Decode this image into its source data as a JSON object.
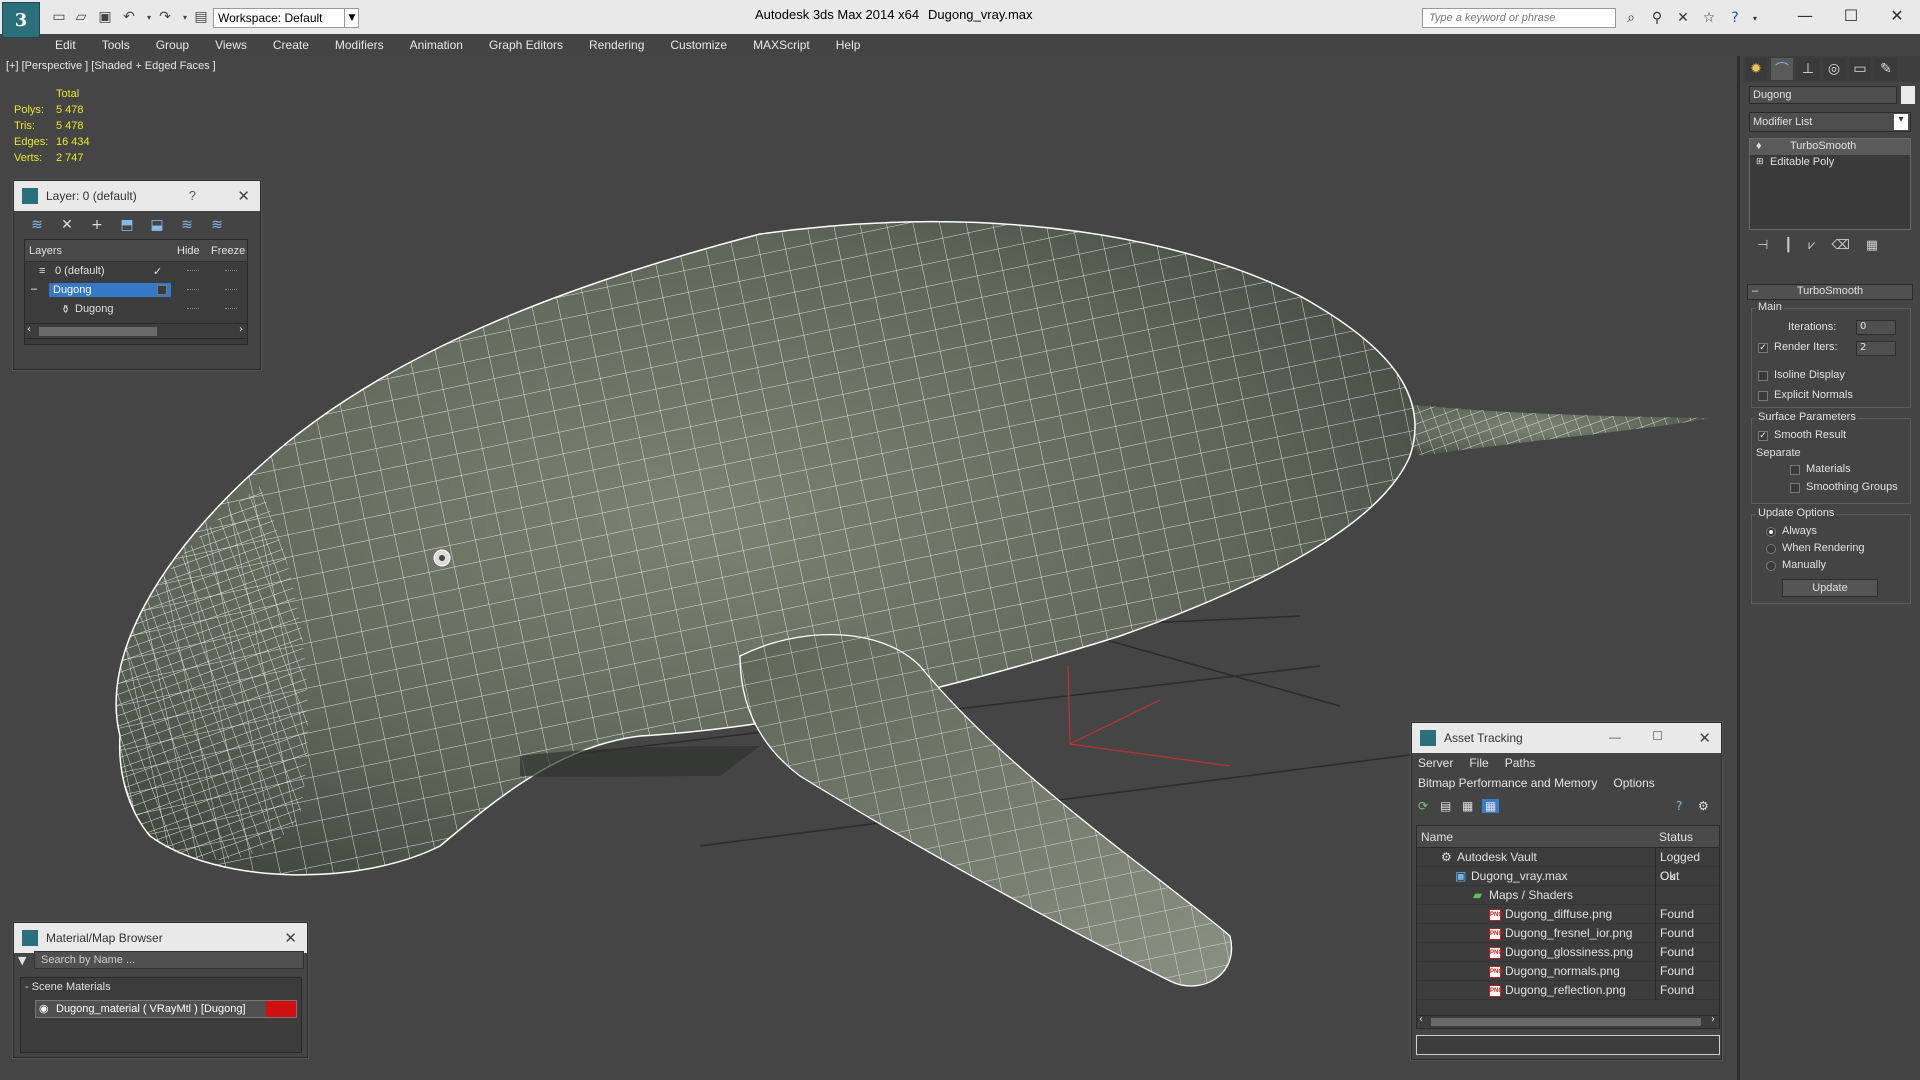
{
  "titlebar": {
    "app_name": "Autodesk 3ds Max  2014 x64",
    "file_name": "Dugong_vray.max",
    "workspace": "Workspace: Default",
    "search_placeholder": "Type a keyword or phrase"
  },
  "menu": [
    "Edit",
    "Tools",
    "Group",
    "Views",
    "Create",
    "Modifiers",
    "Animation",
    "Graph Editors",
    "Rendering",
    "Customize",
    "MAXScript",
    "Help"
  ],
  "viewport": {
    "label": "[+] [Perspective ] [Shaded + Edged Faces ]",
    "stats": {
      "header": "Total",
      "rows": [
        {
          "label": "Polys:",
          "value": "5 478"
        },
        {
          "label": "Tris:",
          "value": "5 478"
        },
        {
          "label": "Edges:",
          "value": "16 434"
        },
        {
          "label": "Verts:",
          "value": "2 747"
        }
      ]
    }
  },
  "layer_panel": {
    "title": "Layer: 0 (default)",
    "help": "?",
    "columns": {
      "layers": "Layers",
      "hide": "Hide",
      "freeze": "Freeze"
    },
    "rows": [
      {
        "name": "0 (default)"
      },
      {
        "name": "Dugong"
      },
      {
        "name": "Dugong"
      }
    ]
  },
  "material_browser": {
    "title": "Material/Map Browser",
    "search_placeholder": "Search by Name ...",
    "section": "- Scene Materials",
    "item": "Dugong_material  ( VRayMtl )  [Dugong]",
    "swatch_color": "#d01010"
  },
  "asset_tracking": {
    "title": "Asset Tracking",
    "menu1": [
      "Server",
      "File",
      "Paths"
    ],
    "menu2": [
      "Bitmap Performance and Memory",
      "Options"
    ],
    "columns": {
      "name": "Name",
      "status": "Status"
    },
    "rows": [
      {
        "name": "Autodesk Vault",
        "status": "Logged Out"
      },
      {
        "name": "Dugong_vray.max",
        "status": "Ok"
      },
      {
        "name": "Maps / Shaders",
        "status": ""
      },
      {
        "name": "Dugong_diffuse.png",
        "status": "Found"
      },
      {
        "name": "Dugong_fresnel_ior.png",
        "status": "Found"
      },
      {
        "name": "Dugong_glossiness.png",
        "status": "Found"
      },
      {
        "name": "Dugong_normals.png",
        "status": "Found"
      },
      {
        "name": "Dugong_reflection.png",
        "status": "Found"
      }
    ]
  },
  "command_panel": {
    "object_name": "Dugong",
    "modifier_list": "Modifier List",
    "stack": [
      "TurboSmooth",
      "Editable Poly"
    ],
    "rollout": "TurboSmooth",
    "main_group": "Main",
    "iterations_label": "Iterations:",
    "iterations_value": "0",
    "render_iters_label": "Render Iters:",
    "render_iters_value": "2",
    "isoline_display": "Isoline Display",
    "explicit_normals": "Explicit Normals",
    "surface_group": "Surface Parameters",
    "smooth_result": "Smooth Result",
    "separate": "Separate",
    "materials": "Materials",
    "smoothing_groups": "Smoothing Groups",
    "update_group": "Update Options",
    "always": "Always",
    "when_rendering": "When Rendering",
    "manually": "Manually",
    "update_button": "Update"
  }
}
